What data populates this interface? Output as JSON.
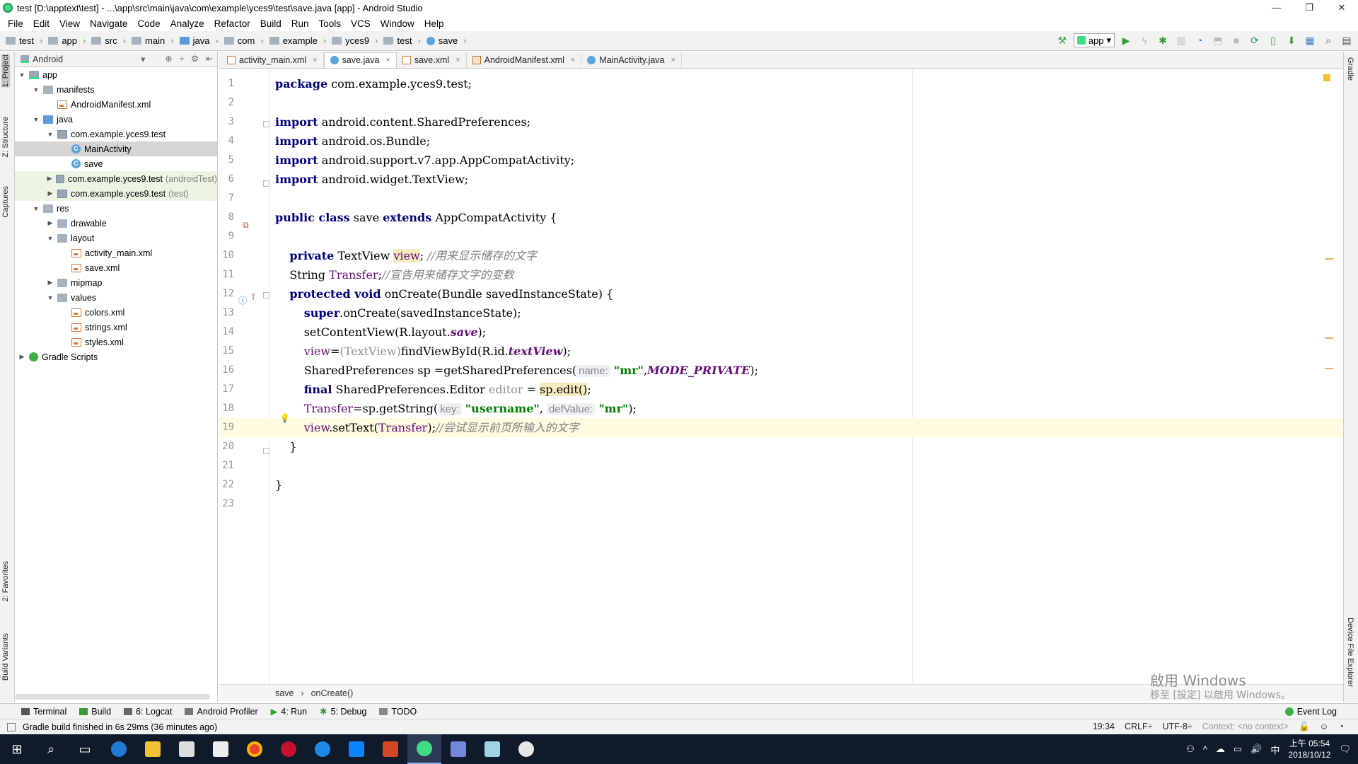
{
  "window": {
    "title": "test [D:\\apptext\\test] - ...\\app\\src\\main\\java\\com\\example\\yces9\\test\\save.java [app] - Android Studio",
    "controls": [
      "—",
      "❐",
      "✕"
    ]
  },
  "menu": [
    "File",
    "Edit",
    "View",
    "Navigate",
    "Code",
    "Analyze",
    "Refactor",
    "Build",
    "Run",
    "Tools",
    "VCS",
    "Window",
    "Help"
  ],
  "breadcrumbs": [
    "test",
    "app",
    "src",
    "main",
    "java",
    "com",
    "example",
    "yces9",
    "test",
    "save"
  ],
  "run_config": "app",
  "left_tabs": {
    "project": "1: Project",
    "structure": "Z: Structure",
    "captures": "Captures",
    "favorites": "2: Favorites",
    "build_variants": "Build Variants"
  },
  "right_tabs": {
    "gradle": "Gradle",
    "device": "Device File Explorer"
  },
  "project_panel": {
    "view_mode": "Android",
    "tree": [
      {
        "label": "app",
        "depth": 0,
        "expanded": true,
        "icon": "app-module-icon"
      },
      {
        "label": "manifests",
        "depth": 1,
        "expanded": true,
        "icon": "folder-icon"
      },
      {
        "label": "AndroidManifest.xml",
        "depth": 2,
        "icon": "manifest-file-icon"
      },
      {
        "label": "java",
        "depth": 1,
        "expanded": true,
        "icon": "folder-blue-icon"
      },
      {
        "label": "com.example.yces9.test",
        "depth": 2,
        "expanded": true,
        "icon": "package-icon"
      },
      {
        "label": "MainActivity",
        "depth": 3,
        "icon": "class-icon",
        "selected": true
      },
      {
        "label": "save",
        "depth": 3,
        "icon": "class-icon"
      },
      {
        "label": "com.example.yces9.test",
        "suffix": "(androidTest)",
        "depth": 2,
        "expanded": false,
        "icon": "package-icon",
        "hilite": true
      },
      {
        "label": "com.example.yces9.test",
        "suffix": "(test)",
        "depth": 2,
        "expanded": false,
        "icon": "package-icon",
        "hilite": true
      },
      {
        "label": "res",
        "depth": 1,
        "expanded": true,
        "icon": "folder-icon"
      },
      {
        "label": "drawable",
        "depth": 2,
        "expanded": false,
        "icon": "folder-icon"
      },
      {
        "label": "layout",
        "depth": 2,
        "expanded": true,
        "icon": "folder-icon"
      },
      {
        "label": "activity_main.xml",
        "depth": 3,
        "icon": "xml-file-icon"
      },
      {
        "label": "save.xml",
        "depth": 3,
        "icon": "xml-file-icon"
      },
      {
        "label": "mipmap",
        "depth": 2,
        "expanded": false,
        "icon": "folder-icon"
      },
      {
        "label": "values",
        "depth": 2,
        "expanded": true,
        "icon": "folder-icon"
      },
      {
        "label": "colors.xml",
        "depth": 3,
        "icon": "xml-file-icon"
      },
      {
        "label": "strings.xml",
        "depth": 3,
        "icon": "xml-file-icon"
      },
      {
        "label": "styles.xml",
        "depth": 3,
        "icon": "xml-file-icon"
      },
      {
        "label": "Gradle Scripts",
        "depth": 0,
        "expanded": false,
        "icon": "gradle-icon"
      }
    ]
  },
  "tabs": [
    {
      "label": "activity_main.xml",
      "type": "xml"
    },
    {
      "label": "save.java",
      "type": "cls",
      "active": true
    },
    {
      "label": "save.xml",
      "type": "xml"
    },
    {
      "label": "AndroidManifest.xml",
      "type": "man"
    },
    {
      "label": "MainActivity.java",
      "type": "cls"
    }
  ],
  "code": {
    "line_numbers": [
      "1",
      "2",
      "3",
      "4",
      "5",
      "6",
      "7",
      "8",
      "9",
      "10",
      "11",
      "12",
      "13",
      "14",
      "15",
      "16",
      "17",
      "18",
      "19",
      "20",
      "21",
      "22",
      "23"
    ],
    "l1": {
      "kw": "package",
      "rest": " com.example.yces9.test;"
    },
    "l3": {
      "kw": "import",
      "rest": " android.content.SharedPreferences;"
    },
    "l4": {
      "kw": "import",
      "rest": " android.os.Bundle;"
    },
    "l5": {
      "kw": "import",
      "rest": " android.support.v7.app.AppCompatActivity;"
    },
    "l6": {
      "kw": "import",
      "rest": " android.widget.TextView;"
    },
    "l8": {
      "kw1": "public class",
      "name": " save ",
      "kw2": "extends",
      "rest": " AppCompatActivity {"
    },
    "l10": {
      "kw": "private",
      "type": " TextView ",
      "field": "view",
      "semi": "; ",
      "comment": "//用来显示储存的文字"
    },
    "l11": {
      "type": "String ",
      "field": "Transfer",
      "semi": ";",
      "comment": "//宣告用来储存文字的变数"
    },
    "l12": {
      "kw": "protected void",
      "rest": " onCreate(Bundle savedInstanceState) {"
    },
    "l13": {
      "kw": "super",
      "rest": ".onCreate(savedInstanceState);"
    },
    "l14": {
      "pre": "setContentView(R.layout.",
      "static": "save",
      "post": ");"
    },
    "l15": {
      "field": "view",
      "pre": "=",
      "dim": "(TextView)",
      "mid": "findViewById(R.id.",
      "static": "textView",
      "post": ");"
    },
    "l16": {
      "pre": "SharedPreferences sp =getSharedPreferences(",
      "hint": "name:",
      "str": "\"mr\"",
      "comma": ",",
      "static": "MODE_PRIVATE",
      "post": ");"
    },
    "l17": {
      "kw": "final",
      "pre": " SharedPreferences.Editor ",
      "dim": "editor",
      "eq": " = ",
      "hl": "sp.edit()",
      "post": ";"
    },
    "l18": {
      "field": "Transfer",
      "pre": "=sp.getString(",
      "hint1": "key:",
      "str1": "\"username\"",
      "comma": ", ",
      "hint2": "defValue:",
      "str2": "\"mr\"",
      "post": ");"
    },
    "l19": {
      "field": "view",
      "pre": ".setText(",
      "field2": "Transfer",
      "post": ");",
      "comment": "//尝试显示前页所输入的文字"
    },
    "l20": "}",
    "l22": "}"
  },
  "editor_breadcrumb": [
    "save",
    "onCreate()"
  ],
  "watermark": {
    "line1": "啟用 Windows",
    "line2": "移至 [設定] 以啟用 Windows。"
  },
  "tool_tabs": [
    "Terminal",
    "Build",
    "6: Logcat",
    "Android Profiler",
    "4: Run",
    "5: Debug",
    "TODO"
  ],
  "event_log": "Event Log",
  "status": {
    "message": "Gradle build finished in 6s 29ms (36 minutes ago)",
    "position": "19:34",
    "line_sep": "CRLF÷",
    "encoding": "UTF-8÷",
    "context": "Context: <no context>"
  },
  "taskbar": {
    "time": "上午 05:54",
    "date": "2018/10/12",
    "ime": "中"
  }
}
